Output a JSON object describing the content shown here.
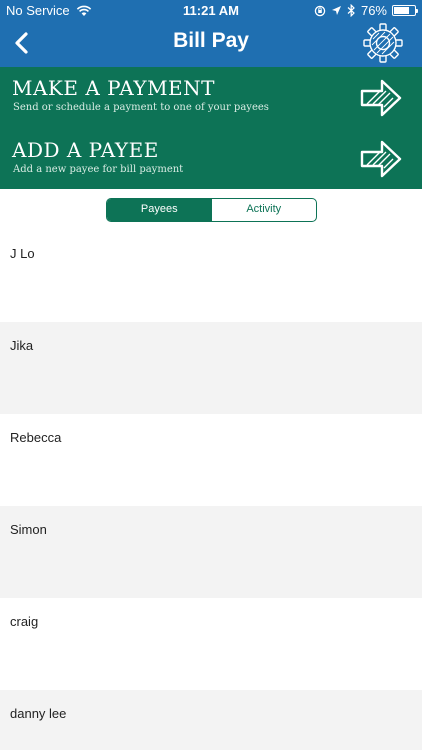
{
  "status_bar": {
    "carrier": "No Service",
    "time": "11:21 AM",
    "battery_percent": "76%",
    "battery_level": 0.76
  },
  "header": {
    "title": "Bill Pay"
  },
  "actions": [
    {
      "title": "MAKE A PAYMENT",
      "subtitle": "Send or schedule a payment to one of your payees"
    },
    {
      "title": "ADD A PAYEE",
      "subtitle": "Add a new payee for bill payment"
    }
  ],
  "tabs": [
    {
      "label": "Payees",
      "active": true
    },
    {
      "label": "Activity",
      "active": false
    }
  ],
  "payees": [
    "J Lo",
    "Jika",
    "Rebecca",
    "Simon",
    "craig",
    "danny lee"
  ],
  "colors": {
    "header_blue": "#1f6fb1",
    "brand_green": "#0d7356",
    "row_alt": "#f3f3f3"
  }
}
